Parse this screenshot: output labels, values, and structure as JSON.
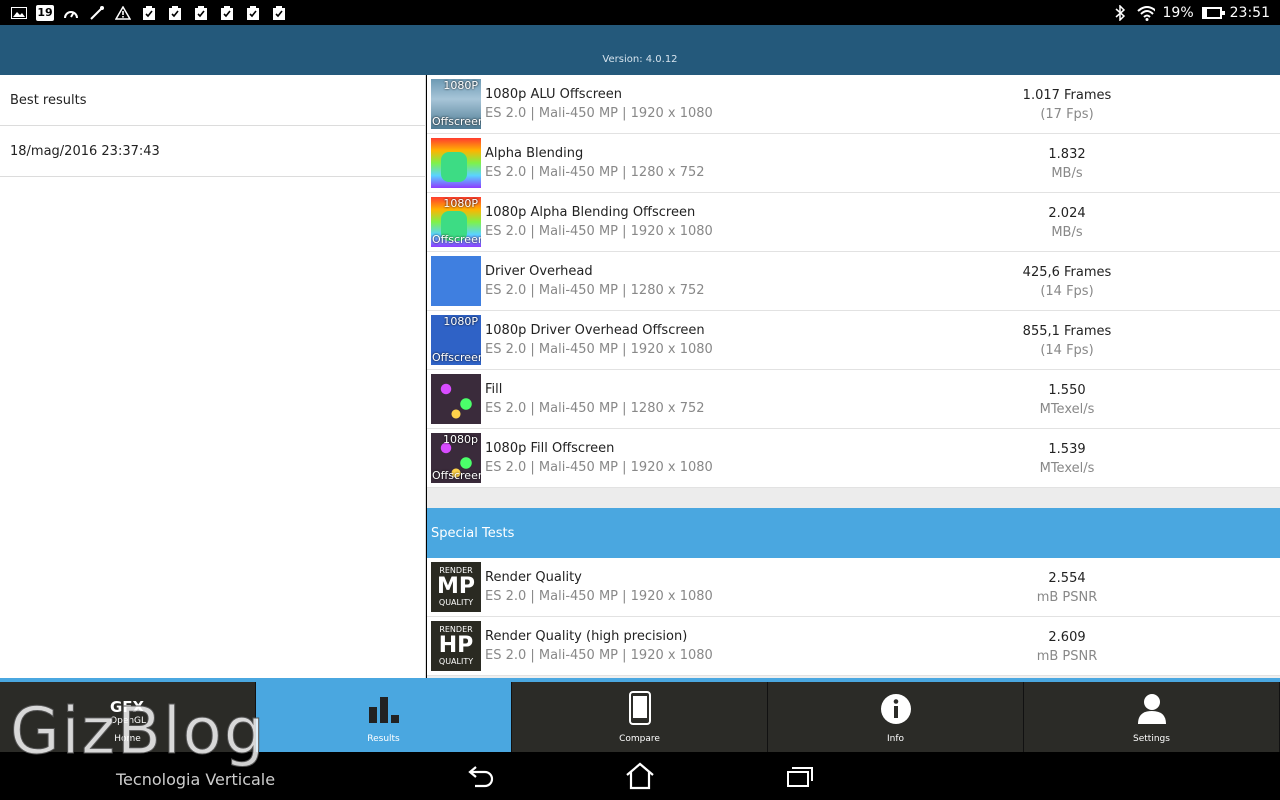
{
  "statusbar": {
    "calendar_day": "19",
    "battery": "19%",
    "battery_level": 0.19,
    "time": "23:51"
  },
  "appbar": {
    "version": "Version: 4.0.12"
  },
  "left": {
    "items": [
      {
        "label": "Best results"
      },
      {
        "label": "18/mag/2016 23:37:43"
      }
    ]
  },
  "results": [
    {
      "thumb": "1080p Offscreen",
      "thumb_top": "1080P",
      "thumb_bottom": "Offscreen",
      "title": "1080p ALU Offscreen",
      "sub": "ES 2.0 | Mali-450 MP | 1920 x 1080",
      "value": "1.017 Frames",
      "unit": "(17 Fps)"
    },
    {
      "thumb": "",
      "thumb_top": "",
      "thumb_bottom": "",
      "title": "Alpha Blending",
      "sub": "ES 2.0 | Mali-450 MP | 1280 x 752",
      "value": "1.832",
      "unit": "MB/s"
    },
    {
      "thumb": "1080P Offscreen",
      "thumb_top": "1080P",
      "thumb_bottom": "Offscreen",
      "title": "1080p Alpha Blending Offscreen",
      "sub": "ES 2.0 | Mali-450 MP | 1920 x 1080",
      "value": "2.024",
      "unit": "MB/s"
    },
    {
      "thumb": "",
      "thumb_top": "",
      "thumb_bottom": "",
      "title": "Driver Overhead",
      "sub": "ES 2.0 | Mali-450 MP | 1280 x 752",
      "value": "425,6 Frames",
      "unit": "(14 Fps)"
    },
    {
      "thumb": "1080P Offscreen",
      "thumb_top": "1080P",
      "thumb_bottom": "Offscreen",
      "title": "1080p Driver Overhead Offscreen",
      "sub": "ES 2.0 | Mali-450 MP | 1920 x 1080",
      "value": "855,1 Frames",
      "unit": "(14 Fps)"
    },
    {
      "thumb": "",
      "thumb_top": "",
      "thumb_bottom": "",
      "title": "Fill",
      "sub": "ES 2.0 | Mali-450 MP | 1280 x 752",
      "value": "1.550",
      "unit": "MTexel/s"
    },
    {
      "thumb": "1080p Offscreen",
      "thumb_top": "1080p",
      "thumb_bottom": "Offscreen",
      "title": "1080p Fill Offscreen",
      "sub": "ES 2.0 | Mali-450 MP | 1920 x 1080",
      "value": "1.539",
      "unit": "MTexel/s"
    }
  ],
  "special": {
    "header": "Special Tests",
    "items": [
      {
        "badge_top": "RENDER",
        "badge_mid": "MP",
        "badge_bottom": "QUALITY",
        "title": "Render Quality",
        "sub": "ES 2.0 | Mali-450 MP | 1920 x 1080",
        "value": "2.554",
        "unit": "mB PSNR"
      },
      {
        "badge_top": "RENDER",
        "badge_mid": "HP",
        "badge_bottom": "QUALITY",
        "title": "Render Quality (high precision)",
        "sub": "ES 2.0 | Mali-450 MP | 1920 x 1080",
        "value": "2.609",
        "unit": "mB PSNR"
      }
    ]
  },
  "nav": {
    "gfx": "GFX",
    "gfx_sub": "OpenGL",
    "home": "Home",
    "results": "Results",
    "compare": "Compare",
    "info": "Info",
    "settings": "Settings"
  },
  "watermark": {
    "title": "GizBlog",
    "subtitle": "Tecnologia Verticale"
  },
  "colors": {
    "appbar": "#24597b",
    "accent": "#4aa7e0",
    "nav_bg": "#2b2b27"
  }
}
